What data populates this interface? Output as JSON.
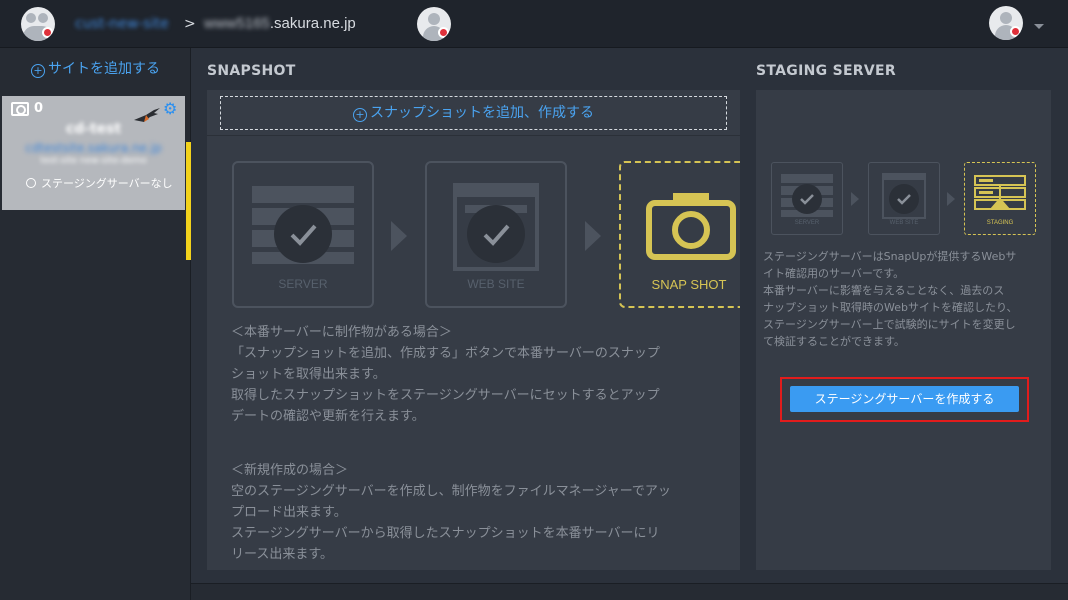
{
  "header": {
    "account_name": "cust-new-site",
    "separator": ">",
    "host_blurred": "www5165",
    "host_suffix": ".sakura.ne.jp"
  },
  "sidebar": {
    "add_site_label": "サイトを追加する",
    "site_card": {
      "snapshot_count": "0",
      "title": "cd-test",
      "url": "cdtestsite.sakura.ne.jp",
      "sub": "test-site new-site-demo",
      "staging_status": "ステージングサーバーなし"
    }
  },
  "snapshot": {
    "section_title": "SNAPSHOT",
    "add_label": "スナップショットを追加、作成する",
    "steps": {
      "server": "SERVER",
      "website": "WEB SITE",
      "snapshot": "SNAP SHOT"
    },
    "desc_existing_title": "＜本番サーバーに制作物がある場合＞",
    "desc_existing_1": "「スナップショットを追加、作成する」ボタンで本番サーバーのスナップ",
    "desc_existing_2": "ショットを取得出来ます。",
    "desc_existing_3": "取得したスナップショットをステージングサーバーにセットするとアップ",
    "desc_existing_4": "デートの確認や更新を行えます。",
    "desc_new_title": "＜新規作成の場合＞",
    "desc_new_1": "空のステージングサーバーを作成し、制作物をファイルマネージャーでアッ",
    "desc_new_2": "プロード出来ます。",
    "desc_new_3": "ステージングサーバーから取得したスナップショットを本番サーバーにリ",
    "desc_new_4": "リース出来ます。"
  },
  "staging": {
    "section_title": "STAGING SERVER",
    "steps": {
      "server": "SERVER",
      "website": "WEB SITE",
      "staging": "STAGING"
    },
    "desc_1": "ステージングサーバーはSnapUpが提供するWebサ",
    "desc_2": "イト確認用のサーバーです。",
    "desc_3": "本番サーバーに影響を与えることなく、過去のス",
    "desc_4": "ナップショット取得時のWebサイトを確認したり、",
    "desc_5": "ステージングサーバー上で試験的にサイトを変更し",
    "desc_6": "て検証することができます。",
    "create_button": "ステージングサーバーを作成する"
  },
  "colors": {
    "accent_blue": "#3a9bf2",
    "highlight_yellow": "#f2d21c",
    "snapshot_gold": "#d6c454",
    "alert_red": "#e21c1c"
  }
}
